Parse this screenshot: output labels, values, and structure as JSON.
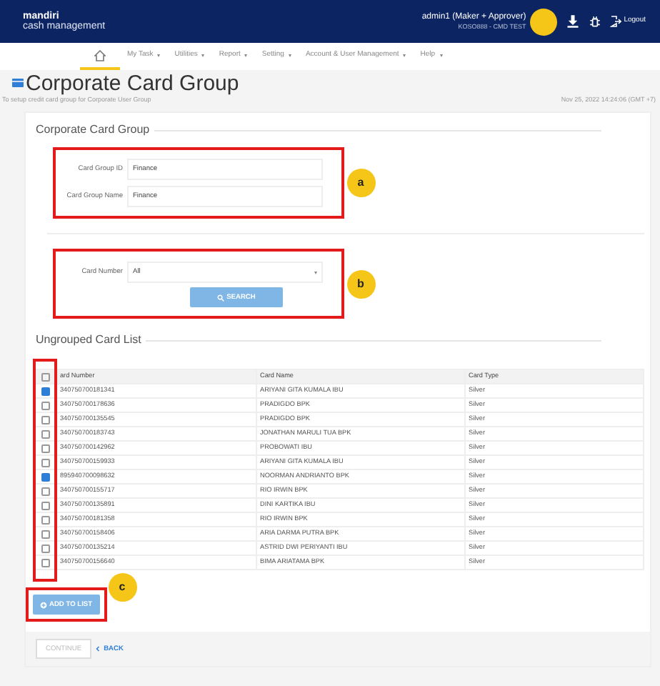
{
  "header": {
    "brand": "mandiri",
    "brand_sub": "cash management",
    "user": "admin1 (Maker + Approver)",
    "company": "KOSO888 - CMD TEST",
    "logout": "Logout"
  },
  "menu": [
    {
      "kind": "home",
      "selected": true
    },
    {
      "kind": "dropdown",
      "label": "My Task",
      "selected": false
    },
    {
      "kind": "dropdown",
      "label": "Utilities",
      "selected": false
    },
    {
      "kind": "dropdown",
      "label": "Report",
      "selected": false
    },
    {
      "kind": "dropdown",
      "label": "Setting",
      "selected": false
    },
    {
      "kind": "dropdown",
      "label": "Account & User Management",
      "selected": false
    },
    {
      "kind": "dropdown",
      "label": "Help",
      "selected": false
    }
  ],
  "page": {
    "title": "Corporate Card Group",
    "subtitle": "To setup credit card group for Corporate User Group",
    "timestamp": "Nov 25, 2022 14:24:06 (GMT +7)"
  },
  "form": {
    "section_title": "Corporate Card Group",
    "fields": [
      {
        "label": "Card Group ID",
        "value": "Finance"
      },
      {
        "label": "Card Group Name",
        "value": "Finance"
      }
    ],
    "card_number": {
      "label": "Card Number",
      "value": "All"
    },
    "search_button": "SEARCH"
  },
  "list": {
    "section_title": "Ungrouped Card List",
    "columns": [
      "ard Number",
      "Card Name",
      "Card Type"
    ],
    "header_checked": false,
    "rows": [
      {
        "number": "340750700181341",
        "name": "ARIYANI GITA KUMALA IBU",
        "type": "Silver",
        "checked": true
      },
      {
        "number": "340750700178636",
        "name": "PRADIGDO BPK",
        "type": "Silver",
        "checked": false
      },
      {
        "number": "340750700135545",
        "name": "PRADIGDO BPK",
        "type": "Silver",
        "checked": false
      },
      {
        "number": "340750700183743",
        "name": "JONATHAN MARULI TUA BPK",
        "type": "Silver",
        "checked": false
      },
      {
        "number": "340750700142962",
        "name": "PROBOWATI IBU",
        "type": "Silver",
        "checked": false
      },
      {
        "number": "340750700159933",
        "name": "ARIYANI GITA KUMALA IBU",
        "type": "Silver",
        "checked": false
      },
      {
        "number": "895940700098632",
        "name": "NOORMAN ANDRIANTO BPK",
        "type": "Silver",
        "checked": true
      },
      {
        "number": "340750700155717",
        "name": "RIO IRWIN BPK",
        "type": "Silver",
        "checked": false
      },
      {
        "number": "340750700135891",
        "name": "DINI KARTIKA IBU",
        "type": "Silver",
        "checked": false
      },
      {
        "number": "340750700181358",
        "name": "RIO IRWIN BPK",
        "type": "Silver",
        "checked": false
      },
      {
        "number": "340750700158406",
        "name": "ARIA DARMA PUTRA BPK",
        "type": "Silver",
        "checked": false
      },
      {
        "number": "340750700135214",
        "name": "ASTRID DWI PERIYANTI IBU",
        "type": "Silver",
        "checked": false
      },
      {
        "number": "340750700156640",
        "name": "BIMA ARIATAMA BPK",
        "type": "Silver",
        "checked": false
      }
    ]
  },
  "add_button": "ADD TO LIST",
  "footer": {
    "continue": "CONTINUE",
    "continue_disabled": true,
    "back": "BACK"
  },
  "annotations": [
    {
      "label": "a"
    },
    {
      "label": "b"
    },
    {
      "label": "c"
    }
  ]
}
